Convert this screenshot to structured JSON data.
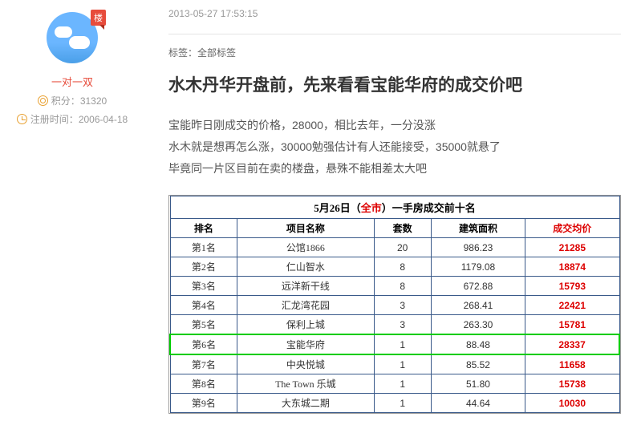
{
  "user": {
    "name": "一对一双",
    "badge": "楼",
    "points_label": "积分：",
    "points": "31320",
    "regdate_label": "注册时间：",
    "regdate": "2006-04-18"
  },
  "post": {
    "timestamp": "2013-05-27 17:53:15",
    "tags_label": "标签：全部标签",
    "title": "水木丹华开盘前，先来看看宝能华府的成交价吧",
    "line1": "宝能昨日刚成交的价格，28000，相比去年，一分没涨",
    "line2": "水木就是想再怎么涨，30000勉强估计有人还能接受，35000就悬了",
    "line3": "毕竟同一片区目前在卖的楼盘，悬殊不能相差太大吧"
  },
  "chart_data": {
    "type": "table",
    "title_prefix": "5月26日（",
    "title_red": "全市",
    "title_suffix": "）一手房成交前十名",
    "headers": {
      "rank": "排名",
      "project": "项目名称",
      "units": "套数",
      "area": "建筑面积",
      "price": "成交均价"
    },
    "rows": [
      {
        "rank": "第1名",
        "project": "公馆1866",
        "units": "20",
        "area": "986.23",
        "price": "21285",
        "hl": false
      },
      {
        "rank": "第2名",
        "project": "仁山智水",
        "units": "8",
        "area": "1179.08",
        "price": "18874",
        "hl": false
      },
      {
        "rank": "第3名",
        "project": "远洋新干线",
        "units": "8",
        "area": "672.88",
        "price": "15793",
        "hl": false
      },
      {
        "rank": "第4名",
        "project": "汇龙湾花园",
        "units": "3",
        "area": "268.41",
        "price": "22421",
        "hl": false
      },
      {
        "rank": "第5名",
        "project": "保利上城",
        "units": "3",
        "area": "263.30",
        "price": "15781",
        "hl": false
      },
      {
        "rank": "第6名",
        "project": "宝能华府",
        "units": "1",
        "area": "88.48",
        "price": "28337",
        "hl": true
      },
      {
        "rank": "第7名",
        "project": "中央悦城",
        "units": "1",
        "area": "85.52",
        "price": "11658",
        "hl": false
      },
      {
        "rank": "第8名",
        "project": "The Town 乐城",
        "units": "1",
        "area": "51.80",
        "price": "15738",
        "hl": false
      },
      {
        "rank": "第9名",
        "project": "大东城二期",
        "units": "1",
        "area": "44.64",
        "price": "10030",
        "hl": false
      }
    ]
  }
}
